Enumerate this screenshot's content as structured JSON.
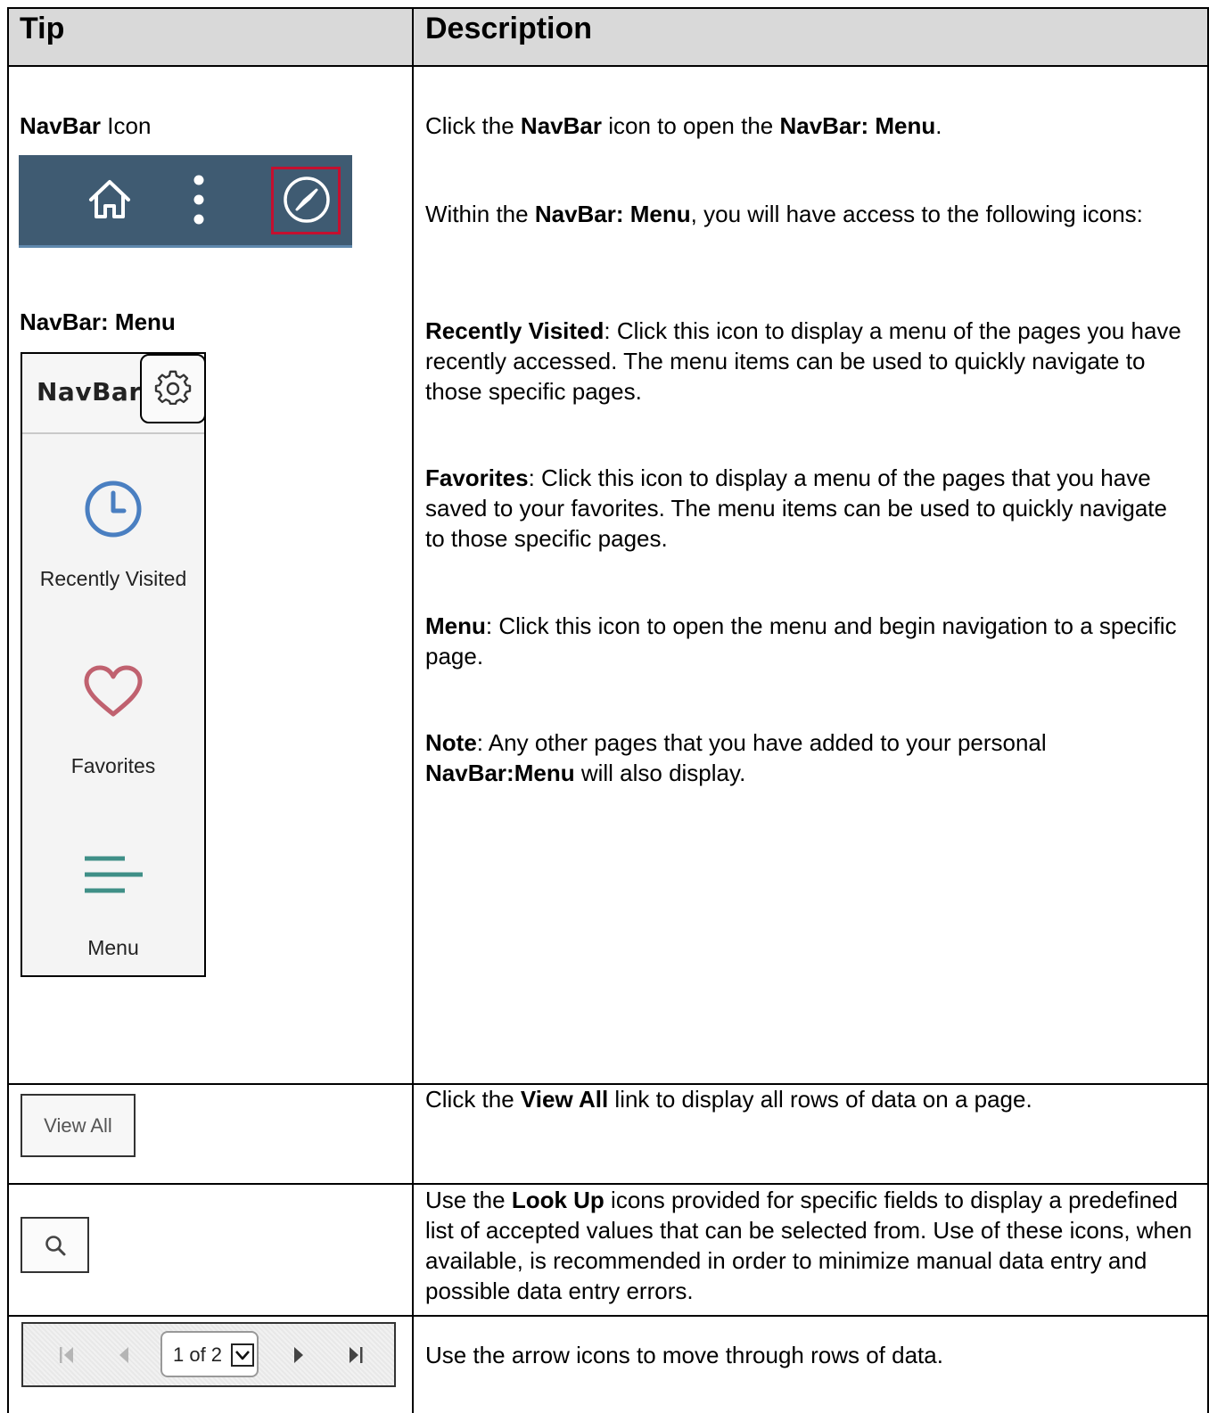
{
  "table": {
    "header": {
      "tip": "Tip",
      "description": "Description"
    }
  },
  "row_navbar": {
    "tip_navbar_icon": {
      "bold": "NavBar",
      "rest": " Icon"
    },
    "navbar_strip_icons": [
      "home-icon",
      "more-vertical-icon",
      "compass-icon"
    ],
    "tip_navbar_menu_heading": "NavBar: Menu",
    "navbar_menu": {
      "title": "NavBar",
      "items": [
        {
          "label": "Recently Visited",
          "icon": "clock-icon"
        },
        {
          "label": "Favorites",
          "icon": "heart-icon"
        },
        {
          "label": "Menu",
          "icon": "menu-lines-icon"
        }
      ]
    },
    "desc": {
      "p1": {
        "t1": "Click the ",
        "b1": "NavBar",
        "t2": " icon to open the ",
        "b2": "NavBar: Menu",
        "t3": "."
      },
      "p2": {
        "t1": "Within the ",
        "b1": "NavBar: Menu",
        "t2": ", you will have access to the following icons:"
      },
      "p3": {
        "b1": "Recently Visited",
        "t1": ": Click this icon to display a menu of the pages you have recently accessed.  The menu items can be used to quickly navigate to those specific pages."
      },
      "p4": {
        "b1": "Favorites",
        "t1": ": Click this icon to display a menu of the pages that you have saved to your favorites.  The menu items can be used to quickly navigate to those specific pages."
      },
      "p5": {
        "b1": "Menu",
        "t1": ": Click this icon to open the menu and begin navigation to a specific page."
      },
      "p6": {
        "b1": "Note",
        "t1": ": Any other pages that you have added to your personal ",
        "b2": "NavBar:Menu",
        "t2": " will also display."
      }
    }
  },
  "row_viewall": {
    "button_label": "View All",
    "desc": {
      "t1": "Click the ",
      "b1": "View All",
      "t2": " link to display all rows of data on a page."
    }
  },
  "row_lookup": {
    "icon": "search-icon",
    "desc": {
      "t1": "Use the ",
      "b1": "Look Up",
      "t2": " icons provided for specific fields to display a predefined list of accepted values that can be selected from.  Use of these icons, when available, is recommended in order to minimize manual data entry and possible data entry errors."
    }
  },
  "row_pager": {
    "pager_text": "1 of 2",
    "desc": "Use the arrow icons to move through rows of data."
  },
  "colors": {
    "navbar_bg": "#3f5b72",
    "highlight": "#c4102f",
    "clock": "#4a7fc1",
    "heart": "#c0616f",
    "menu_lines": "#3f8f87",
    "header_bg": "#d9d9d9"
  }
}
